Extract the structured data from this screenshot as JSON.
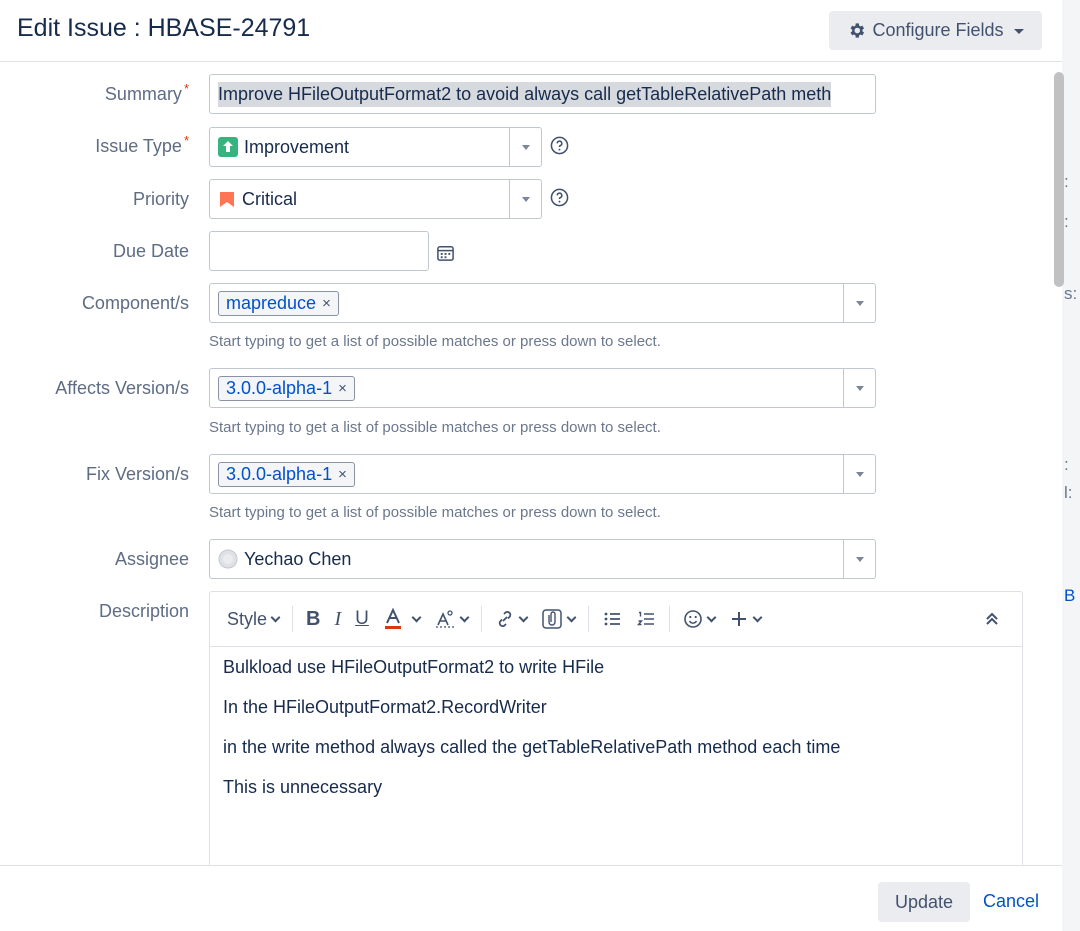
{
  "dialog": {
    "title": "Edit Issue : HBASE-24791",
    "configure_fields_label": "Configure Fields"
  },
  "fields": {
    "summary": {
      "label": "Summary",
      "value": "Improve HFileOutputFormat2 to avoid always call getTableRelativePath meth"
    },
    "issue_type": {
      "label": "Issue Type",
      "value": "Improvement"
    },
    "priority": {
      "label": "Priority",
      "value": "Critical"
    },
    "due_date": {
      "label": "Due Date",
      "value": ""
    },
    "components": {
      "label": "Component/s",
      "tag": "mapreduce",
      "hint": "Start typing to get a list of possible matches or press down to select."
    },
    "affects_version": {
      "label": "Affects Version/s",
      "tag": "3.0.0-alpha-1",
      "hint": "Start typing to get a list of possible matches or press down to select."
    },
    "fix_version": {
      "label": "Fix Version/s",
      "tag": "3.0.0-alpha-1",
      "hint": "Start typing to get a list of possible matches or press down to select."
    },
    "assignee": {
      "label": "Assignee",
      "value": "Yechao Chen"
    },
    "description": {
      "label": "Description",
      "toolbar_style_label": "Style",
      "paragraphs": [
        "Bulkload use HFileOutputFormat2 to write HFile",
        "In the HFileOutputFormat2.RecordWriter",
        "in the write method always called the getTableRelativePath method each time",
        "This is unnecessary"
      ]
    }
  },
  "required_marker": "*",
  "tag_remove_glyph": "×",
  "footer": {
    "update_label": "Update",
    "cancel_label": "Cancel"
  },
  "background_fragments": [
    ":",
    ":",
    "s:",
    ":",
    "l:",
    "B"
  ],
  "colors": {
    "accent": "#0052cc",
    "required": "#de350b",
    "improvement": "#36b37e",
    "critical": "#ff7452"
  }
}
